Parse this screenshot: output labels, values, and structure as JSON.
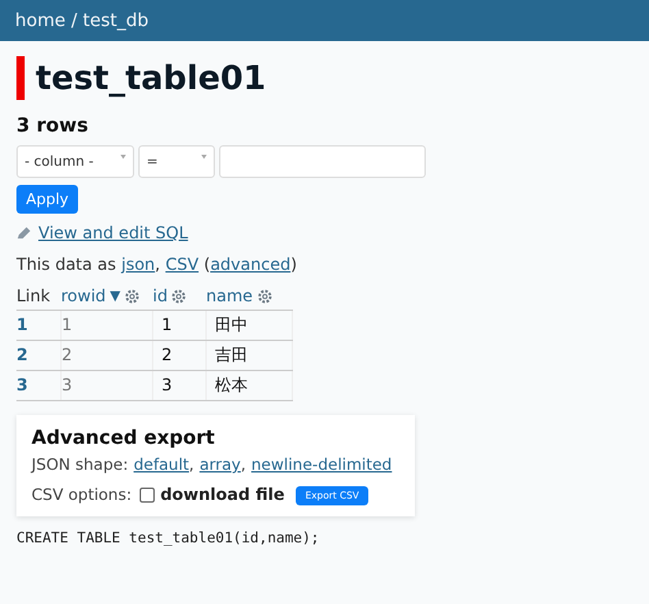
{
  "breadcrumb": "home / test_db",
  "title": "test_table01",
  "row_count": "3 rows",
  "filters": {
    "column_select": "- column -",
    "operator_select": "=",
    "apply_button": "Apply"
  },
  "sql_link": "View and edit SQL",
  "data_as": {
    "prefix": "This data as",
    "json": "json",
    "sep": ",",
    "csv": "CSV",
    "open_paren": "(",
    "advanced": "advanced",
    "close_paren": ")"
  },
  "table": {
    "columns": [
      {
        "label": "Link",
        "kind": "plain"
      },
      {
        "label": "rowid",
        "kind": "sorted",
        "sort_indicator": "▼"
      },
      {
        "label": "id",
        "kind": "gear"
      },
      {
        "label": "name",
        "kind": "gear"
      }
    ],
    "rows": [
      [
        "1",
        "1",
        "1",
        "田中"
      ],
      [
        "2",
        "2",
        "2",
        "吉田"
      ],
      [
        "3",
        "3",
        "3",
        "松本"
      ]
    ]
  },
  "advanced_export": {
    "title": "Advanced export",
    "json_shape_label": "JSON shape:",
    "json_shapes": [
      "default",
      "array",
      "newline-delimited"
    ],
    "json_shape_separator": ",",
    "csv_label": "CSV options:",
    "download_file": {
      "label": "download file",
      "checked": false
    },
    "export_button": "Export CSV"
  },
  "sql": "CREATE TABLE test_table01(id,name);"
}
